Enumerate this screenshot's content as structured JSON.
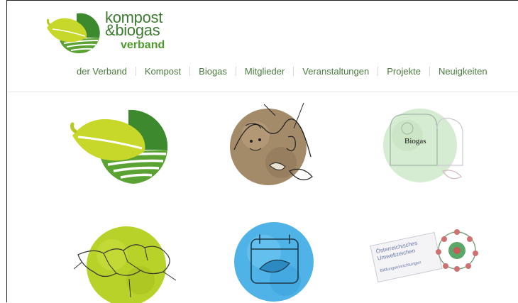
{
  "logo": {
    "line1": "kompost",
    "line2": "&biogas",
    "line3": "verband"
  },
  "nav": {
    "items": [
      {
        "label": "der Verband"
      },
      {
        "label": "Kompost"
      },
      {
        "label": "Biogas"
      },
      {
        "label": "Mitglieder"
      },
      {
        "label": "Veranstaltungen"
      },
      {
        "label": "Projekte"
      },
      {
        "label": "Neuigkeiten"
      }
    ]
  },
  "tiles": {
    "biogas_label": "Biogas",
    "badge": {
      "line1": "Österreichisches",
      "line2": "Umweltzeichen",
      "line3": "Bildungseinrichtungen"
    }
  },
  "colors": {
    "brand_green": "#3d7a32",
    "leaf_yellow": "#c8d82a",
    "accent_blue": "#4fb3e8",
    "soil_brown": "#a38b6a"
  }
}
